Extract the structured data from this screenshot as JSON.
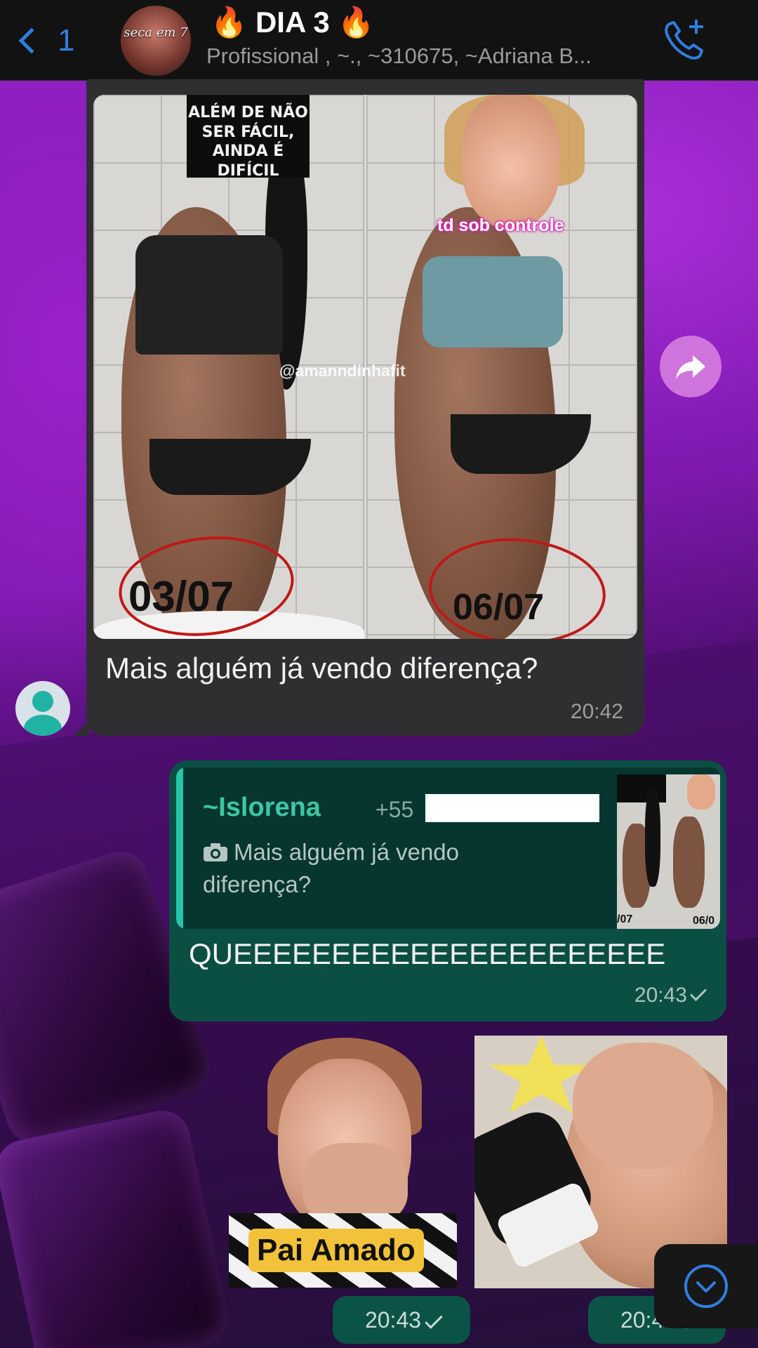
{
  "header": {
    "back_count": "1",
    "avatar_text": "seca em 7",
    "title": "🔥 DIA 3 🔥",
    "subtitle": "Profissional , ~., ~310675, ~Adriana B..."
  },
  "incoming": {
    "image": {
      "caption_overlay": "ALÉM DE NÃO SER FÁCIL, AINDA É DIFÍCIL",
      "sticker_text": "td sob controle",
      "watermark": "@amanndinhafit",
      "date_left": "03/07",
      "date_right": "06/07"
    },
    "text": "Mais alguém já vendo diferença?",
    "time": "20:42"
  },
  "outgoing": {
    "quote": {
      "sender": "~Islorena",
      "phone": "+55",
      "text": "Mais alguém já vendo diferença?",
      "thumb_left": "/07",
      "thumb_right": "06/0"
    },
    "text": "QUEEEEEEEEEEEEEEEEEEEEEE",
    "time": "20:43"
  },
  "stickers": [
    {
      "label": "Pai Amado",
      "time": "20:43"
    },
    {
      "label": "",
      "time": "20:43"
    }
  ],
  "colors": {
    "accent_blue": "#2f7fe0",
    "incoming_bubble": "#2f2f31",
    "outgoing_bubble": "#0b4e44",
    "quote_name": "#3cc7a6",
    "forward_button": "#cf74dc"
  },
  "icons": {
    "back": "chevron-left-icon",
    "call": "phone-plus-icon",
    "forward": "forward-icon",
    "camera": "camera-icon",
    "scroll_down": "chevron-down-icon"
  }
}
